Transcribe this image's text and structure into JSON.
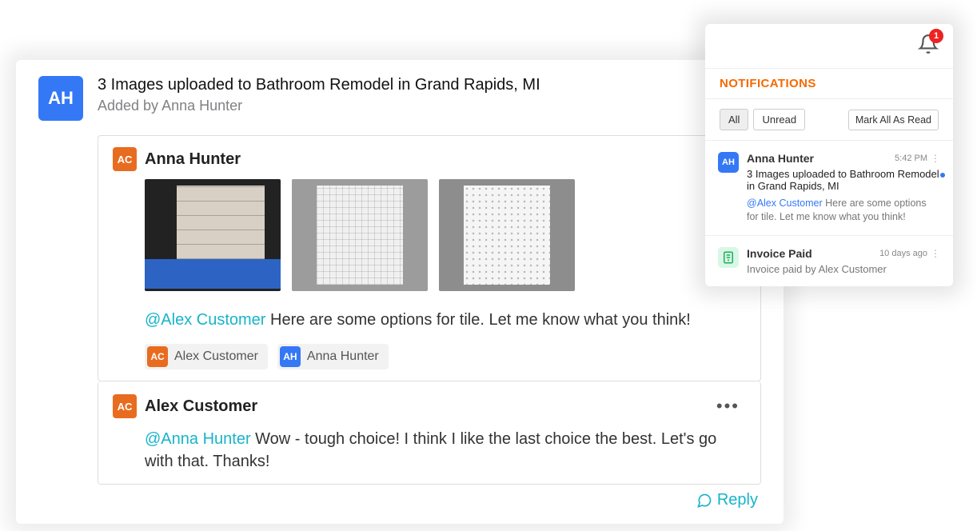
{
  "thread": {
    "avatar_initials": "AH",
    "avatar_color": "blue",
    "title": "3 Images uploaded to Bathroom Remodel in Grand Rapids, MI",
    "subtitle": "Added by Anna Hunter"
  },
  "posts": [
    {
      "author_initials": "AC",
      "author_color": "orange",
      "author_name": "Anna Hunter",
      "images": [
        "tile-a",
        "tile-b",
        "tile-c"
      ],
      "mention": "@Alex Customer",
      "text_after": " Here are some options for tile. Let me know what you think!",
      "tags": [
        {
          "initials": "AC",
          "color": "orange",
          "label": "Alex Customer"
        },
        {
          "initials": "AH",
          "color": "blue",
          "label": "Anna Hunter"
        }
      ]
    },
    {
      "author_initials": "AC",
      "author_color": "orange",
      "author_name": "Alex Customer",
      "mention": "@Anna Hunter",
      "text_after": " Wow - tough choice! I think I like the last choice the best. Let's go with that. Thanks!"
    }
  ],
  "reply_label": "Reply",
  "notifications": {
    "title": "NOTIFICATIONS",
    "badge_count": "1",
    "filters": {
      "all": "All",
      "unread": "Unread"
    },
    "mark_all": "Mark All As Read",
    "items": [
      {
        "type": "user",
        "initials": "AH",
        "color": "blue",
        "name": "Anna Hunter",
        "time": "5:42 PM",
        "headline": "3 Images uploaded to Bathroom Remodel in Grand Rapids, MI",
        "unread": true,
        "sub_mention": "@Alex Customer",
        "sub_text": " Here are some options for tile. Let me know what you think!"
      },
      {
        "type": "invoice",
        "name": "Invoice Paid",
        "time": "10 days ago",
        "headline": "Invoice paid by Alex Customer"
      }
    ]
  }
}
